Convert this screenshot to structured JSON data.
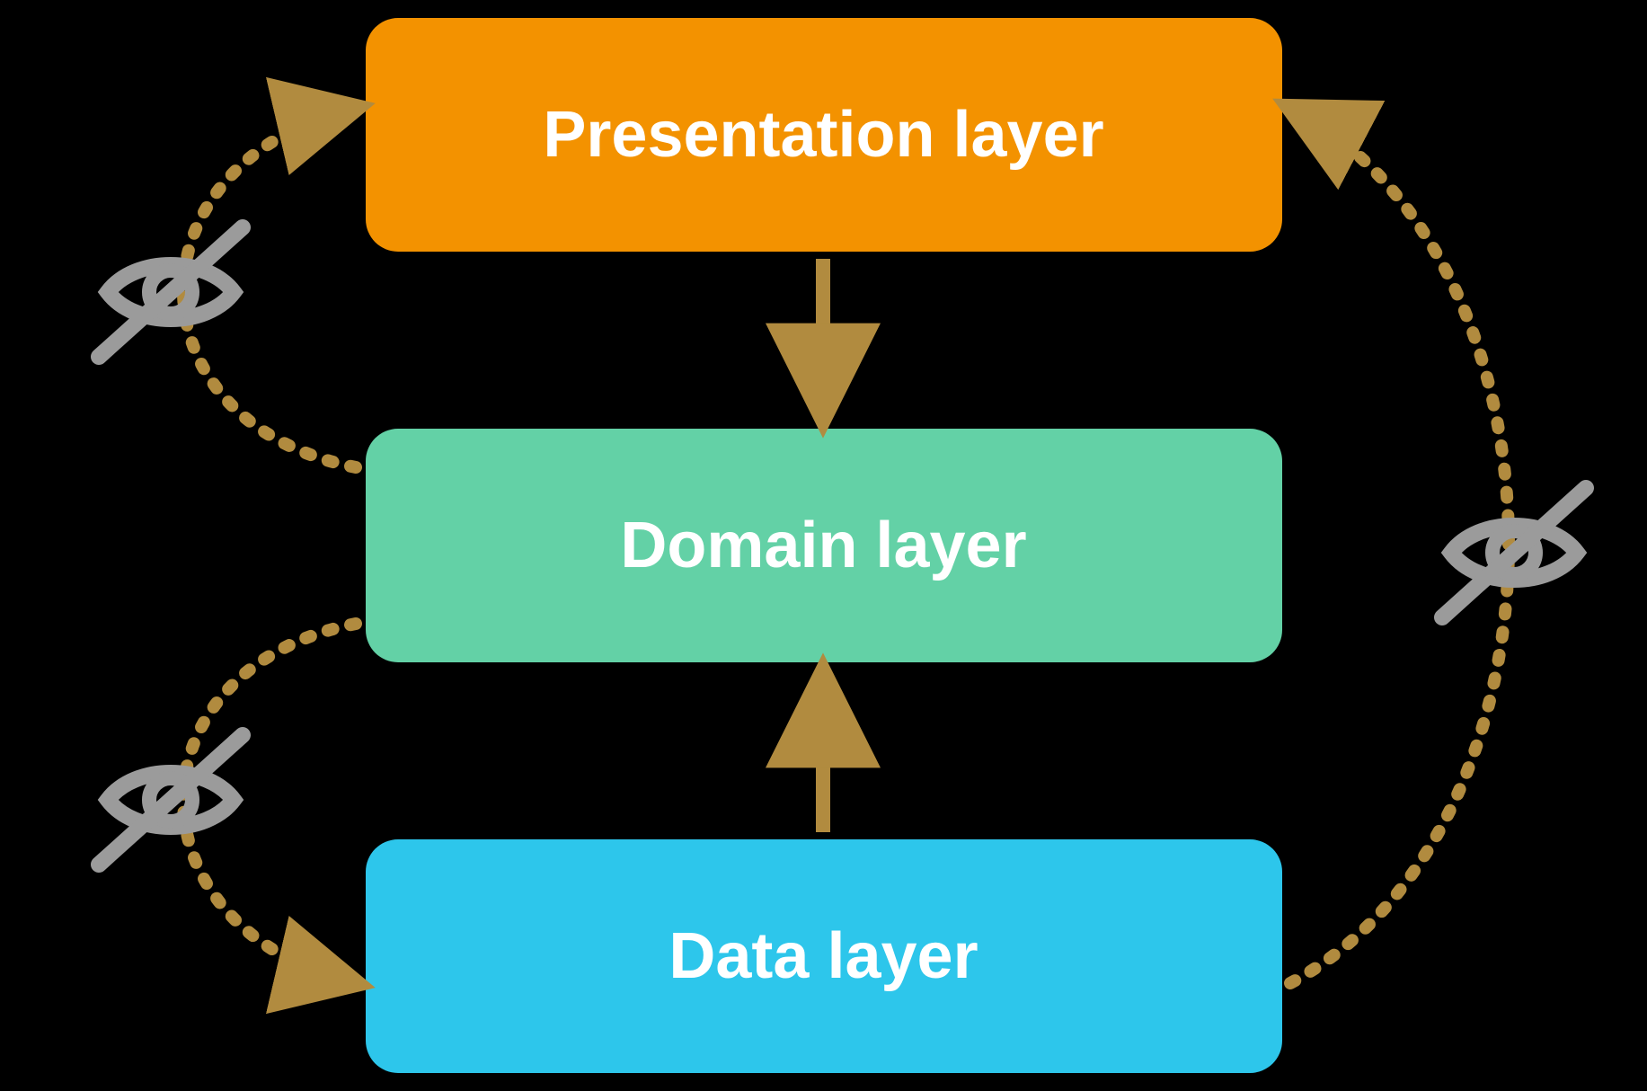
{
  "layers": {
    "presentation": {
      "label": "Presentation layer",
      "color": "#f39200"
    },
    "domain": {
      "label": "Domain layer",
      "color": "#63d1a6"
    },
    "data": {
      "label": "Data layer",
      "color": "#2dc6eb"
    }
  },
  "arrows": {
    "color": "#b18b3f",
    "center_down": {
      "from": "presentation",
      "to": "domain",
      "style": "solid"
    },
    "center_up": {
      "from": "data",
      "to": "domain",
      "style": "solid"
    },
    "left_top": {
      "from": "domain",
      "to": "presentation",
      "style": "dotted",
      "hidden": true
    },
    "left_bottom": {
      "from": "domain",
      "to": "data",
      "style": "dotted",
      "hidden": true
    },
    "right_full": {
      "from": "data",
      "to": "presentation",
      "style": "dotted",
      "hidden": true
    }
  },
  "icons": {
    "hidden_eye": {
      "meaning": "not-visible",
      "color": "#9b9b9b"
    }
  }
}
